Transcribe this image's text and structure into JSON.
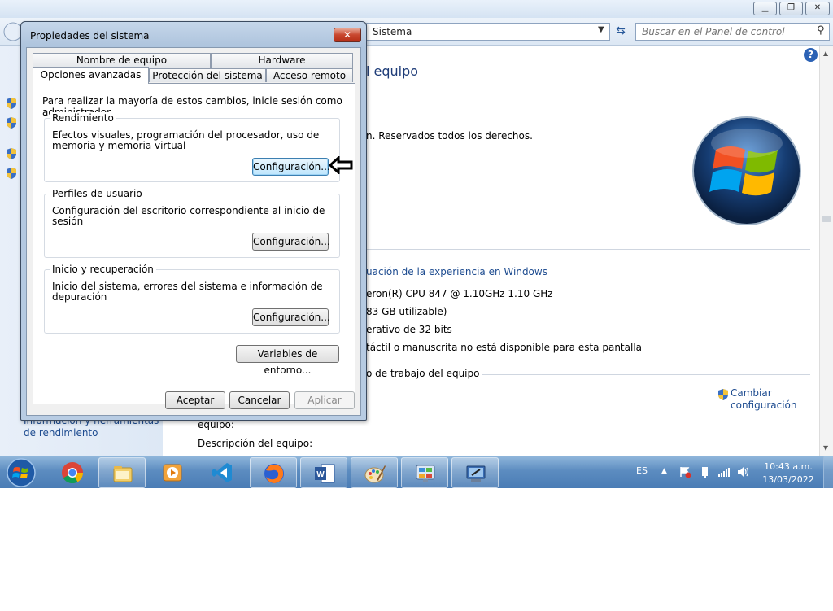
{
  "control_panel": {
    "address": "Sistema",
    "search_placeholder": "Buscar en el Panel de control",
    "heading": "l equipo",
    "copyright": "n. Reservados todos los derechos.",
    "experience_link": "uación de la experiencia en Windows",
    "processor": "eron(R) CPU 847 @ 1.10GHz   1.10 GHz",
    "memory": "83 GB utilizable)",
    "system_type": "erativo de 32 bits",
    "pen_touch": "táctil o manuscrita no está disponible para esta pantalla",
    "group_label": "o de trabajo del equipo",
    "change_settings": "Cambiar configuración",
    "field_computer": "equipo:",
    "field_description": "Descripción del equipo:",
    "sidebar_perf_link": "Información y herramientas de rendimiento",
    "help": "?"
  },
  "dialog": {
    "title": "Propiedades del sistema",
    "close": "✕",
    "tabs_top": [
      "Nombre de equipo",
      "Hardware"
    ],
    "tabs_bottom": [
      "Opciones avanzadas",
      "Protección del sistema",
      "Acceso remoto"
    ],
    "intro": "Para realizar la mayoría de estos cambios, inicie sesión como administrador.",
    "performance": {
      "legend": "Rendimiento",
      "text": "Efectos visuales, programación del procesador, uso de memoria y memoria virtual",
      "button": "Configuración..."
    },
    "profiles": {
      "legend": "Perfiles de usuario",
      "text": "Configuración del escritorio correspondiente al inicio de sesión",
      "button": "Configuración..."
    },
    "startup": {
      "legend": "Inicio y recuperación",
      "text": "Inicio del sistema, errores del sistema e información de depuración",
      "button": "Configuración..."
    },
    "env_button": "Variables de entorno...",
    "ok": "Aceptar",
    "cancel": "Cancelar",
    "apply": "Aplicar"
  },
  "taskbar": {
    "language": "ES",
    "time": "10:43 a.m.",
    "date": "13/03/2022",
    "items": [
      "chrome-icon",
      "file-explorer-icon",
      "media-player-icon",
      "vscode-icon",
      "firefox-icon",
      "word-icon",
      "paint-icon",
      "control-panel-icon",
      "system-properties-icon"
    ]
  },
  "colors": {
    "link": "#1e4c90",
    "taskbar": "#5c8cc0",
    "close_red": "#c8462e"
  }
}
